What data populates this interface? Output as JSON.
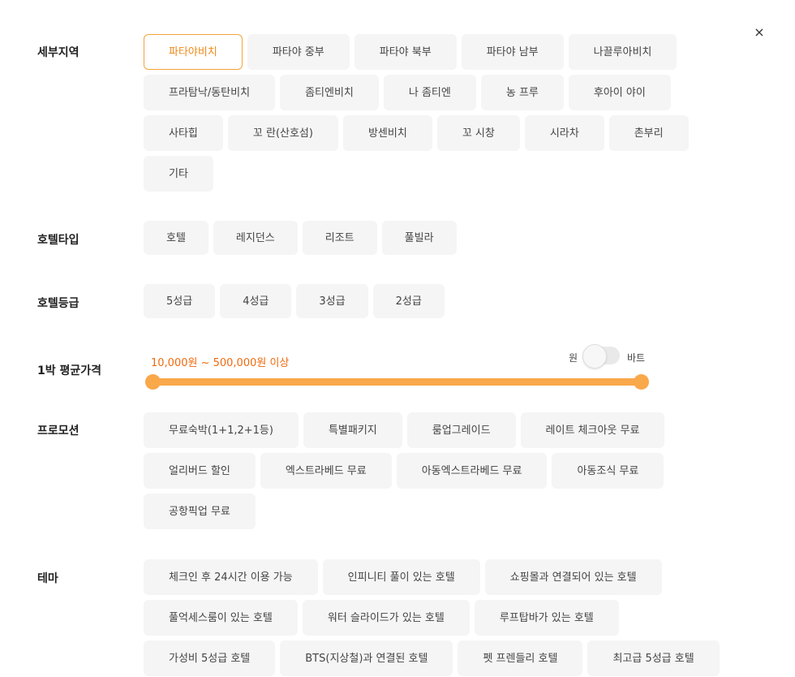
{
  "close": {
    "glyph": "×"
  },
  "region": {
    "label": "세부지역",
    "options": [
      "파타야비치",
      "파타야 중부",
      "파타야 북부",
      "파타야 남부",
      "나끌루아비치",
      "프라탐낙/동탄비치",
      "좀티엔비치",
      "나 좀티엔",
      "농 프루",
      "후아이 야이",
      "사타힙",
      "꼬 란(산호섬)",
      "방센비치",
      "꼬 시창",
      "시라차",
      "촌부리",
      "기타"
    ],
    "selected": "파타야비치"
  },
  "hotel_type": {
    "label": "호텔타입",
    "options": [
      "호텔",
      "레지던스",
      "리조트",
      "풀빌라"
    ]
  },
  "hotel_grade": {
    "label": "호텔등급",
    "options": [
      "5성급",
      "4성급",
      "3성급",
      "2성급"
    ]
  },
  "price": {
    "label": "1박 평균가격",
    "range_text": "10,000원 ~ 500,000원 이상",
    "min": 10000,
    "max": 500000,
    "selected_min_fraction": 0.0,
    "selected_max_fraction": 1.0,
    "unit_won": "원",
    "unit_baht": "바트",
    "unit_toggle_on": false,
    "accent": "#f9a84a",
    "text_color": "#f06a0f"
  },
  "promotion": {
    "label": "프로모션",
    "options": [
      "무료숙박(1+1,2+1등)",
      "특별패키지",
      "룸업그레이드",
      "레이트 체크아웃 무료",
      "얼리버드 할인",
      "엑스트라베드 무료",
      "아동엑스트라베드 무료",
      "아동조식 무료",
      "공항픽업 무료"
    ]
  },
  "theme": {
    "label": "테마",
    "options": [
      "체크인 후 24시간 이용 가능",
      "인피니티 풀이 있는 호텔",
      "쇼핑몰과 연결되어 있는 호텔",
      "풀억세스룸이 있는 호텔",
      "워터 슬라이드가 있는 호텔",
      "루프탑바가 있는 호텔",
      "가성비 5성급 호텔",
      "BTS(지상철)과 연결된 호텔",
      "펫 프렌들리 호텔",
      "최고급 5성급 호텔"
    ]
  }
}
